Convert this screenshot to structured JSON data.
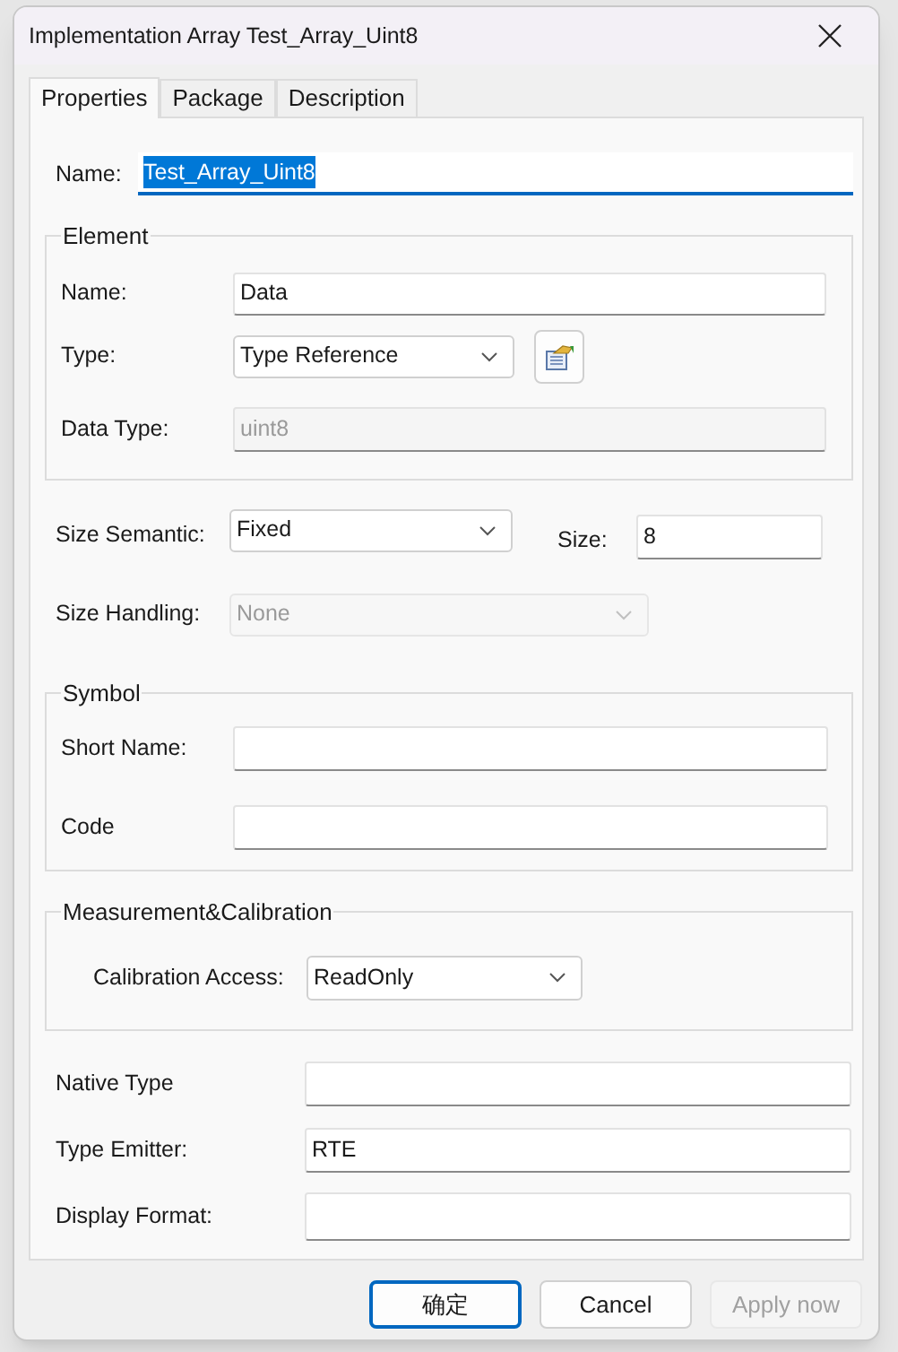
{
  "window": {
    "title": "Implementation Array Test_Array_Uint8"
  },
  "tabs": [
    {
      "label": "Properties",
      "selected": true
    },
    {
      "label": "Package",
      "selected": false
    },
    {
      "label": "Description",
      "selected": false
    }
  ],
  "name_field": {
    "label": "Name:",
    "value": "Test_Array_Uint8",
    "text_selected": true
  },
  "element": {
    "title": "Element",
    "name": {
      "label": "Name:",
      "value": "Data"
    },
    "type": {
      "label": "Type:",
      "value": "Type Reference"
    },
    "data_type": {
      "label": "Data Type:",
      "value": "uint8",
      "disabled": true
    }
  },
  "size_semantic": {
    "label": "Size Semantic:",
    "value": "Fixed"
  },
  "size": {
    "label": "Size:",
    "value": "8"
  },
  "size_handling": {
    "label": "Size Handling:",
    "value": "None",
    "disabled": true
  },
  "symbol": {
    "title": "Symbol",
    "short_name": {
      "label": "Short Name:"
    },
    "code": {
      "label": "Code"
    }
  },
  "measurement_calibration": {
    "title": "Measurement&Calibration",
    "calibration_access": {
      "label": "Calibration Access:",
      "value": "ReadOnly"
    }
  },
  "native_type": {
    "label": "Native Type"
  },
  "type_emitter": {
    "label": "Type Emitter:",
    "value": "RTE"
  },
  "display_format": {
    "label": "Display Format:"
  },
  "buttons": [
    {
      "label": "确定",
      "default": true,
      "disabled": false
    },
    {
      "label": "Cancel",
      "default": false,
      "disabled": false
    },
    {
      "label": "Apply now",
      "default": false,
      "disabled": true
    }
  ]
}
